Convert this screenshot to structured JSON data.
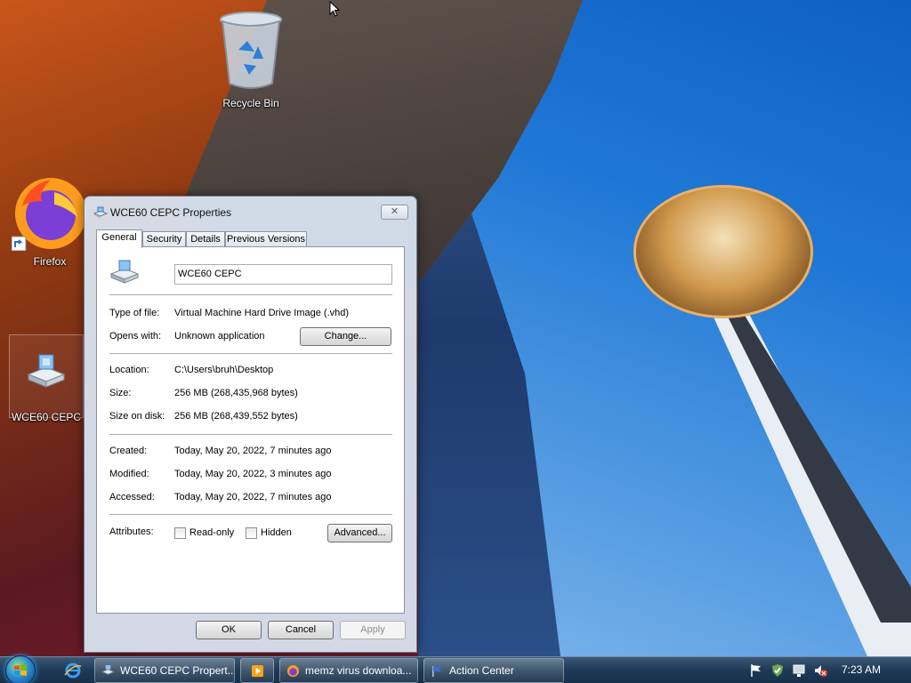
{
  "desktop": {
    "icons": [
      {
        "label": "Recycle Bin",
        "icon": "recycle-bin-icon"
      },
      {
        "label": "Firefox",
        "icon": "firefox-icon"
      },
      {
        "label": "WCE60 CEPC",
        "icon": "hard-drive-image-icon"
      }
    ]
  },
  "window": {
    "title": "WCE60 CEPC Properties",
    "close_label": "✕",
    "tabs": [
      "General",
      "Security",
      "Details",
      "Previous Versions"
    ],
    "active_tab": "General",
    "file_name": "WCE60 CEPC",
    "rows": {
      "type_label": "Type of file:",
      "type_value": "Virtual Machine Hard Drive Image (.vhd)",
      "opens_label": "Opens with:",
      "opens_value": "Unknown application",
      "location_label": "Location:",
      "location_value": "C:\\Users\\bruh\\Desktop",
      "size_label": "Size:",
      "size_value": "256 MB (268,435,968 bytes)",
      "size_disk_label": "Size on disk:",
      "size_disk_value": "256 MB (268,439,552 bytes)",
      "created_label": "Created:",
      "created_value": "Today, May 20, 2022, 7 minutes ago",
      "modified_label": "Modified:",
      "modified_value": "Today, May 20, 2022, 3 minutes ago",
      "accessed_label": "Accessed:",
      "accessed_value": "Today, May 20, 2022, 7 minutes ago",
      "attributes_label": "Attributes:"
    },
    "attributes": {
      "readonly_label": "Read-only",
      "readonly_checked": false,
      "hidden_label": "Hidden",
      "hidden_checked": false
    },
    "buttons": {
      "change": "Change...",
      "advanced": "Advanced...",
      "ok": "OK",
      "cancel": "Cancel",
      "apply": "Apply"
    }
  },
  "taskbar": {
    "items": [
      {
        "label": "WCE60 CEPC Propert...",
        "icon": "properties-icon"
      },
      {
        "label": "",
        "icon": "media-player-icon"
      },
      {
        "label": "memz virus downloa...",
        "icon": "firefox-icon"
      },
      {
        "label": "Action Center",
        "icon": "flag-icon"
      }
    ],
    "time": "7:23 AM"
  },
  "colors": {
    "taskbar": "#1f3a56",
    "window_frame": "#dce8f6",
    "sky": "#1f78d6"
  }
}
